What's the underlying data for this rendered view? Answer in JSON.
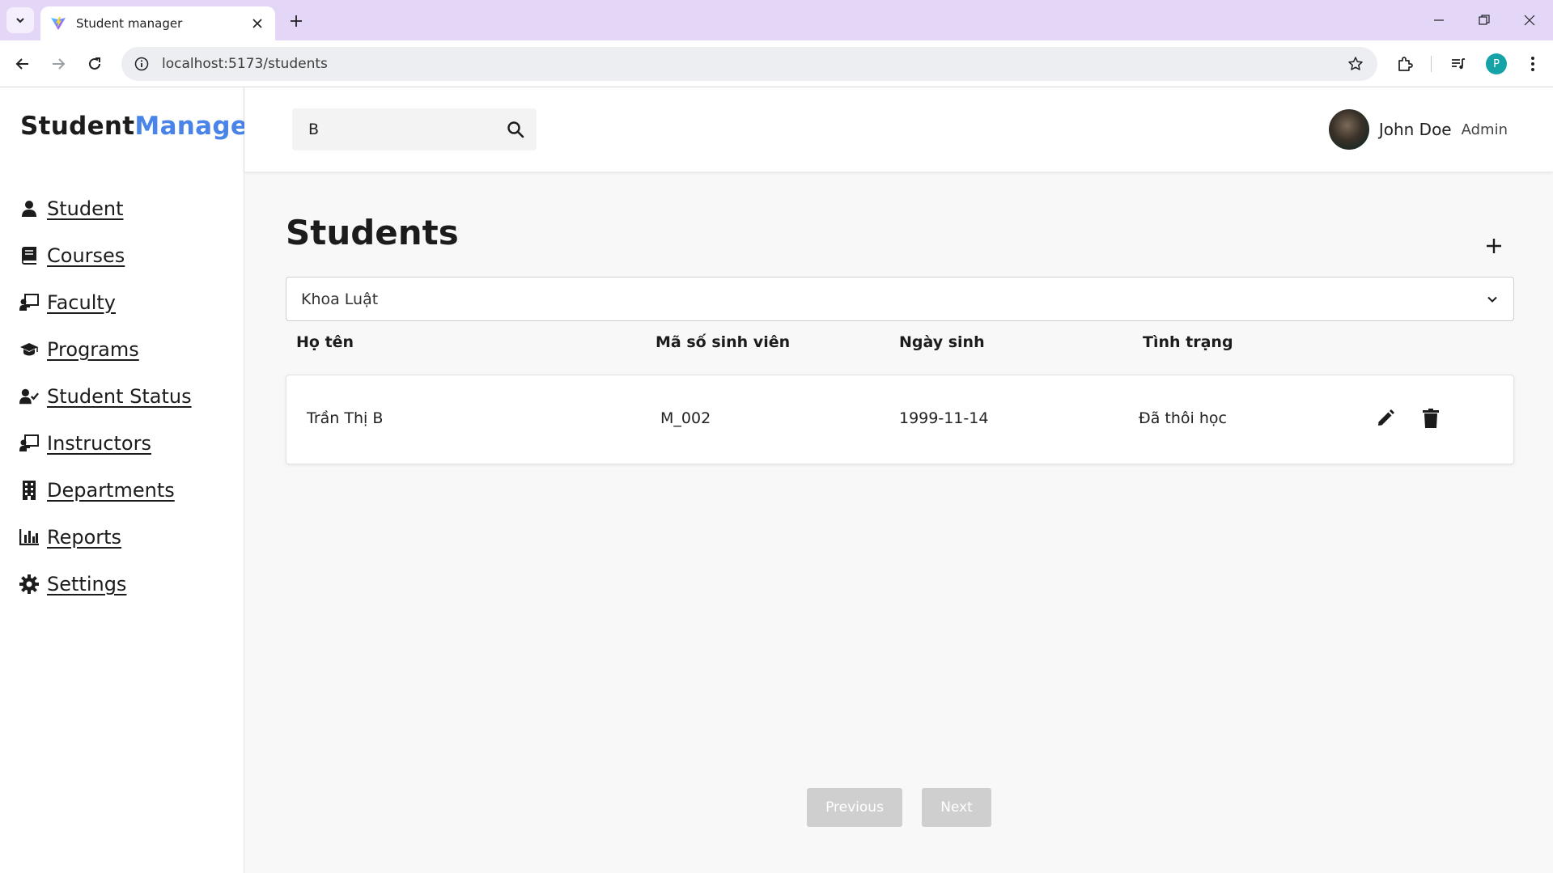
{
  "browser": {
    "tab_title": "Student manager",
    "url": "localhost:5173/students",
    "profile_initial": "P"
  },
  "app": {
    "brand_primary": "Student",
    "brand_accent": "Manager",
    "accent_color": "#4a84e8"
  },
  "sidebar": {
    "items": [
      {
        "label": "Student",
        "icon": "user-icon"
      },
      {
        "label": "Courses",
        "icon": "book-icon"
      },
      {
        "label": "Faculty",
        "icon": "chalkboard-teacher-icon"
      },
      {
        "label": "Programs",
        "icon": "graduation-cap-icon"
      },
      {
        "label": "Student Status",
        "icon": "user-check-icon"
      },
      {
        "label": "Instructors",
        "icon": "chalkboard-teacher-icon"
      },
      {
        "label": "Departments",
        "icon": "building-icon"
      },
      {
        "label": "Reports",
        "icon": "chart-bar-icon"
      },
      {
        "label": "Settings",
        "icon": "gear-icon"
      }
    ]
  },
  "header": {
    "search_value": "B",
    "user_name": "John Doe",
    "user_role": "Admin"
  },
  "main": {
    "title": "Students",
    "department_selected": "Khoa Luật",
    "columns": [
      "Họ tên",
      "Mã số sinh viên",
      "Ngày sinh",
      "Tình trạng"
    ],
    "rows": [
      {
        "name": "Trần Thị B",
        "student_id": "M_002",
        "dob": "1999-11-14",
        "status": "Đã thôi học"
      }
    ],
    "pager": {
      "previous": "Previous",
      "next": "Next"
    }
  }
}
